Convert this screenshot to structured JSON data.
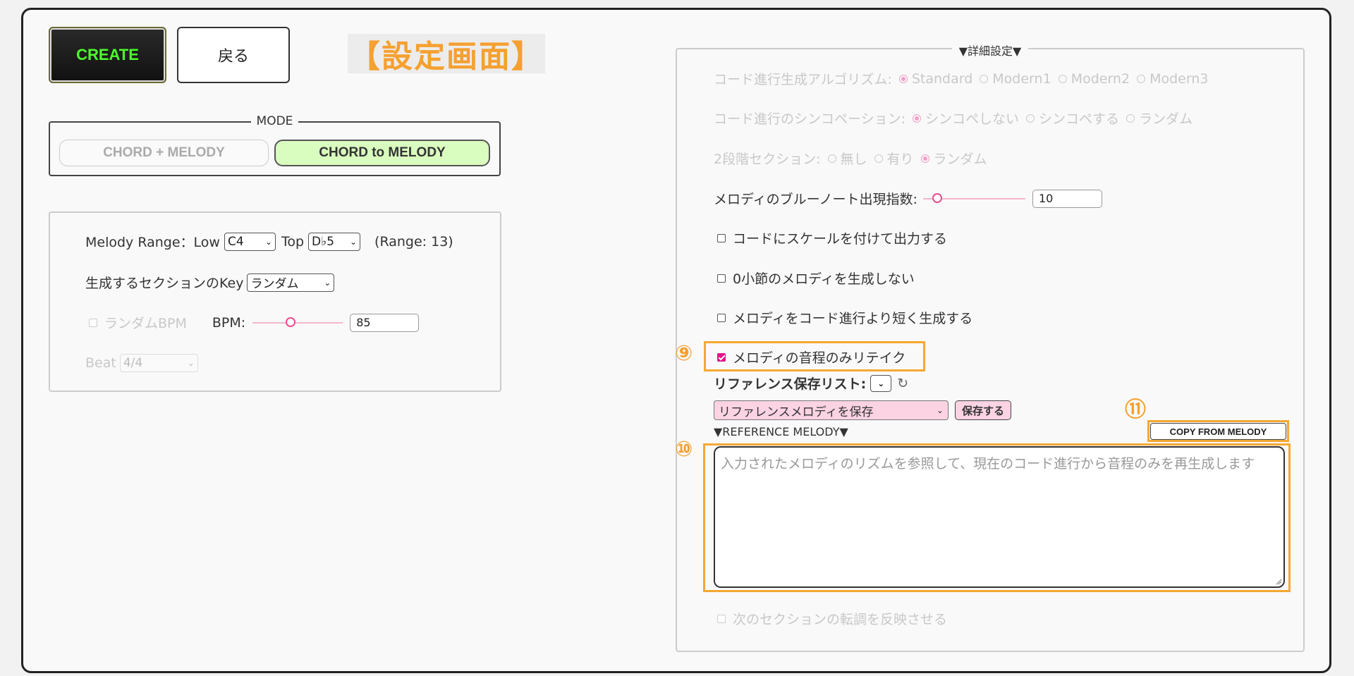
{
  "header": {
    "create_label": "CREATE",
    "back_label": "戻る",
    "page_label": "【設定画面】"
  },
  "mode": {
    "legend": "MODE",
    "options": [
      "CHORD + MELODY",
      "CHORD to MELODY"
    ],
    "selected": "CHORD to MELODY"
  },
  "left": {
    "melody_range_label": "Melody Range：Low",
    "low_value": "C4",
    "top_label": "Top",
    "top_value": "D♭5",
    "range_text": "(Range: 13)",
    "key_label": "生成するセクションのKey",
    "key_value": "ランダム",
    "random_bpm_label": "ランダムBPM",
    "bpm_label": "BPM:",
    "bpm_value": "85",
    "bpm_level": 0.41,
    "beat_label": "Beat",
    "beat_value": "4/4"
  },
  "right": {
    "legend": "▼詳細設定▼",
    "algo_label": "コード進行生成アルゴリズム:",
    "algo_options": [
      "Standard",
      "Modern1",
      "Modern2",
      "Modern3"
    ],
    "algo_selected": "Standard",
    "sync_label": "コード進行のシンコペーション:",
    "sync_options": [
      "シンコペしない",
      "シンコペする",
      "ランダム"
    ],
    "sync_selected": "シンコペしない",
    "twostep_label": "2段階セクション:",
    "twostep_options": [
      "無し",
      "有り",
      "ランダム"
    ],
    "twostep_selected": "ランダム",
    "bluenote_label": "メロディのブルーノート出現指数:",
    "bluenote_value": "10",
    "bluenote_level": 0.1,
    "checkbox_scale": "コードにスケールを付けて出力する",
    "checkbox_zero_bar": "0小節のメロディを生成しない",
    "checkbox_shorter": "メロディをコード進行より短く生成する",
    "checkbox_retake": "メロディの音程のみリテイク",
    "ref_list_label": "リファレンス保存リスト:",
    "refresh_icon": "↻",
    "ref_select_value": "リファレンスメロディを保存",
    "save_button": "保存する",
    "ref_melody_label": "▼REFERENCE MELODY▼",
    "copy_button": "COPY FROM MELODY",
    "ref_placeholder": "入力されたメロディのリズムを参照して、現在のコード進行から音程のみを再生成します",
    "transpose_label": "次のセクションの転調を反映させる"
  },
  "annotations": {
    "badge_9": "⑨",
    "badge_10": "⑩",
    "badge_11": "⑪",
    "color": "#f5a833"
  }
}
